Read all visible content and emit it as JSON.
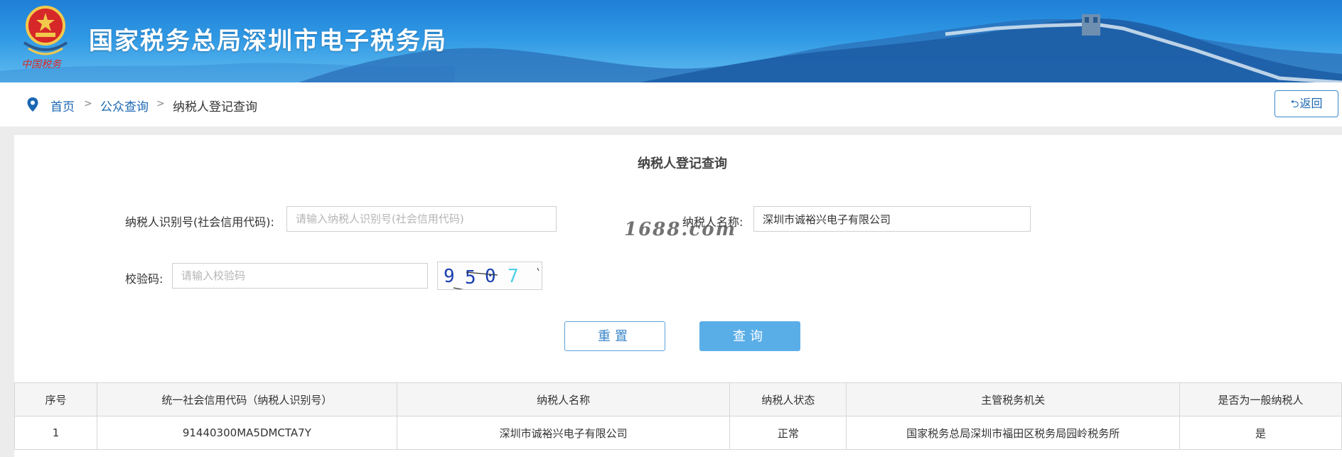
{
  "header": {
    "emblem_caption": "中国税务",
    "site_title": "国家税务总局深圳市电子税务局"
  },
  "breadcrumb": {
    "home": "首页",
    "public_query": "公众查询",
    "current": "纳税人登记查询",
    "separator": ">",
    "back_label": "返回"
  },
  "form": {
    "title": "纳税人登记查询",
    "taxpayer_id_label": "纳税人识别号(社会信用代码):",
    "taxpayer_id_placeholder": "请输入纳税人识别号(社会信用代码)",
    "taxpayer_id_value": "",
    "taxpayer_name_label": "纳税人名称:",
    "taxpayer_name_value": "深圳市诚裕兴电子有限公司",
    "captcha_label": "校验码:",
    "captcha_placeholder": "请输入校验码",
    "captcha_chars": [
      "9",
      "5",
      "0",
      "7"
    ],
    "reset_label": "重置",
    "query_label": "查询"
  },
  "watermark": "1688.com",
  "table": {
    "headers": [
      "序号",
      "统一社会信用代码（纳税人识别号）",
      "纳税人名称",
      "纳税人状态",
      "主管税务机关",
      "是否为一般纳税人"
    ],
    "rows": [
      [
        "1",
        "91440300MA5DMCTA7Y",
        "深圳市诚裕兴电子有限公司",
        "正常",
        "国家税务总局深圳市福田区税务局园岭税务所",
        "是"
      ]
    ]
  },
  "colors": {
    "header_gradient_top": "#1f7fd6",
    "header_gradient_bottom": "#62bdf0",
    "link": "#1a67b3",
    "primary_button": "#5aaee8"
  }
}
